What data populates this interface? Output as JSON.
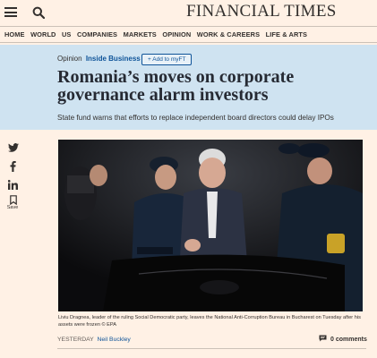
{
  "header": {
    "masthead": "FINANCIAL TIMES"
  },
  "nav": {
    "items": [
      "HOME",
      "WORLD",
      "US",
      "COMPANIES",
      "MARKETS",
      "OPINION",
      "WORK & CAREERS",
      "LIFE & ARTS"
    ]
  },
  "article": {
    "kicker_prefix": "Opinion",
    "kicker_topic": "Inside Business",
    "myft_button": "+ Add to myFT",
    "headline": "Romania’s moves on corporate governance alarm investors",
    "standfirst": "State fund warns that efforts to replace independent board directors could delay IPOs",
    "caption": "Liviu Dragnea, leader of the ruling Social Democratic party, leaves the National Anti-Corruption Bureau in Bucharest on Tuesday after his assets were frozen © EPA",
    "date": "YESTERDAY",
    "author": "Neil Buckley",
    "comments": "0 comments"
  },
  "share": {
    "save_label": "Save",
    "icons": [
      "twitter-icon",
      "facebook-icon",
      "linkedin-icon",
      "bookmark-icon"
    ]
  },
  "colors": {
    "page_bg": "#fff1e5",
    "band_bg": "#cfe3f1",
    "link_blue": "#0f5499"
  }
}
